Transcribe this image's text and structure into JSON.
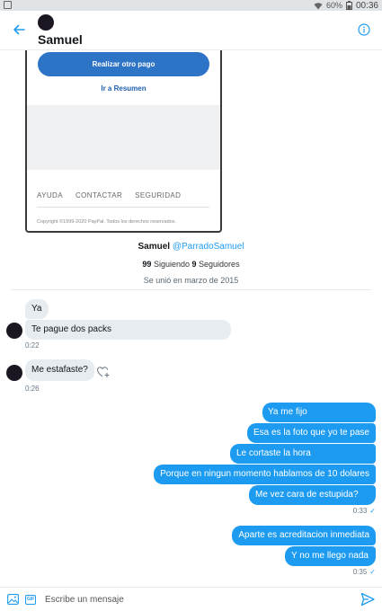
{
  "status_bar": {
    "battery": "60%",
    "time": "00:36"
  },
  "header": {
    "name": "Samuel"
  },
  "shared_image": {
    "button_label": "Realizar otro pago",
    "link_label": "Ir a Resumen",
    "footer_links": [
      "AYUDA",
      "CONTACTAR",
      "SEGURIDAD"
    ],
    "copyright": "Copyright ©1999-2020 PayPal. Todos los derechos reservados."
  },
  "profile": {
    "name": "Samuel",
    "handle": "@ParradoSamuel",
    "following_count": "99",
    "following_label": "Siguiendo",
    "followers_count": "9",
    "followers_label": "Seguidores",
    "joined": "Se unió en marzo de 2015"
  },
  "messages": {
    "in_1": "Ya",
    "in_2": "Te pague dos packs",
    "in_ts_1": "0:22",
    "in_3": "Me estafaste?",
    "in_ts_2": "0:26",
    "out_1": "Ya me fijo",
    "out_2": "Esa es la foto que yo te pase",
    "out_3": "Le cortaste la hora",
    "out_4": "Porque en ningun momento hablamos de 10 dolares",
    "out_5": "Me vez cara de estupida?",
    "out_ts_1": "0:33",
    "out_6": "Aparte es acreditacion inmediata",
    "out_7": "Y no me llego nada",
    "out_ts_2": "0:35"
  },
  "composer": {
    "placeholder": "Escribe un mensaje",
    "gif_label": "GIF"
  },
  "colors": {
    "accent": "#1d9bf0",
    "incoming_bubble": "#e6ecf0",
    "paypal_blue": "#2d74c7"
  },
  "icons": [
    "back-arrow-icon",
    "info-icon",
    "add-reaction-icon",
    "image-icon",
    "gif-icon",
    "send-icon",
    "wifi-icon",
    "battery-icon"
  ]
}
